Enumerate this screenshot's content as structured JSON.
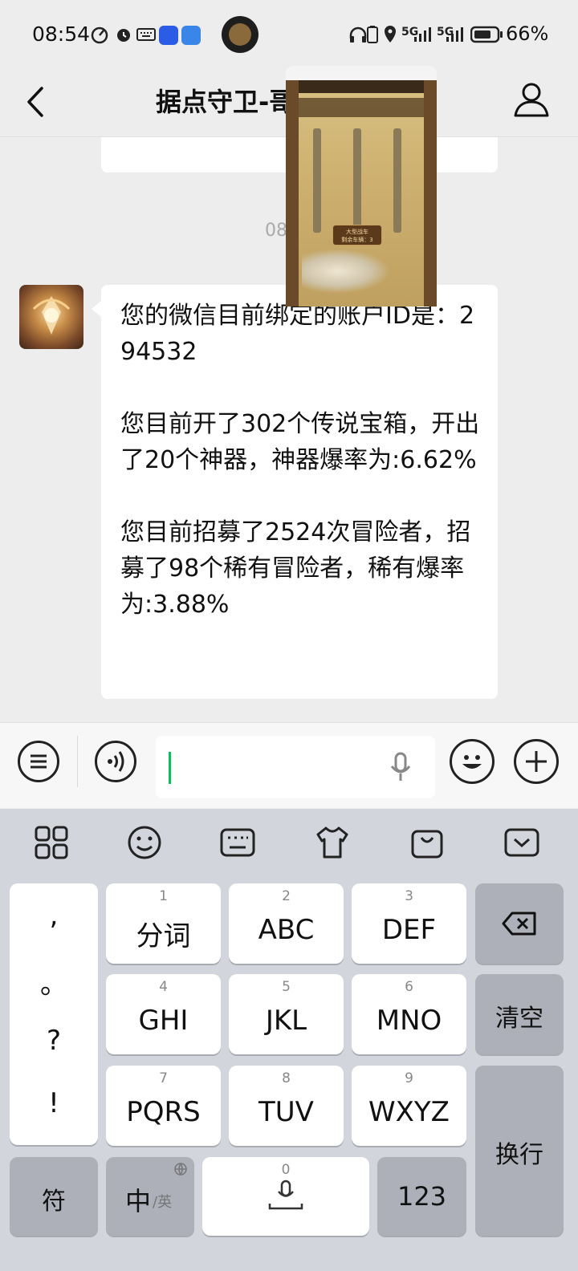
{
  "status_bar": {
    "time": "08:54",
    "battery_percent": "66%",
    "network_1": "5G",
    "network_2": "5G"
  },
  "header": {
    "title": "据点守卫-哥"
  },
  "chat": {
    "timestamp": "08",
    "message": "您的微信目前绑定的账户ID是：294532\n\n您目前开了302个传说宝箱，开出了20个神器，神器爆率为:6.62%\n\n您目前招募了2524次冒险者，招募了98个稀有冒险者，稀有爆率为:3.88%"
  },
  "floating_window": {
    "game_button": "大型战车",
    "game_sub": "剩余车辆：3"
  },
  "keyboard": {
    "keys": {
      "k1": {
        "num": "1",
        "label": "分词"
      },
      "k2": {
        "num": "2",
        "label": "ABC"
      },
      "k3": {
        "num": "3",
        "label": "DEF"
      },
      "k4": {
        "num": "4",
        "label": "GHI"
      },
      "k5": {
        "num": "5",
        "label": "JKL"
      },
      "k6": {
        "num": "6",
        "label": "MNO"
      },
      "k7": {
        "num": "7",
        "label": "PQRS"
      },
      "k8": {
        "num": "8",
        "label": "TUV"
      },
      "k9": {
        "num": "9",
        "label": "WXYZ"
      },
      "k0": {
        "num": "0"
      }
    },
    "punct": [
      ",",
      "。",
      "?",
      "!"
    ],
    "clear": "清空",
    "enter": "换行",
    "symbols": "符",
    "lang_main": "中",
    "lang_alt": "/英",
    "numbers": "123"
  },
  "colors": {
    "accent": "#07c160",
    "background": "#ededed",
    "keyboard": "#d2d5db"
  }
}
